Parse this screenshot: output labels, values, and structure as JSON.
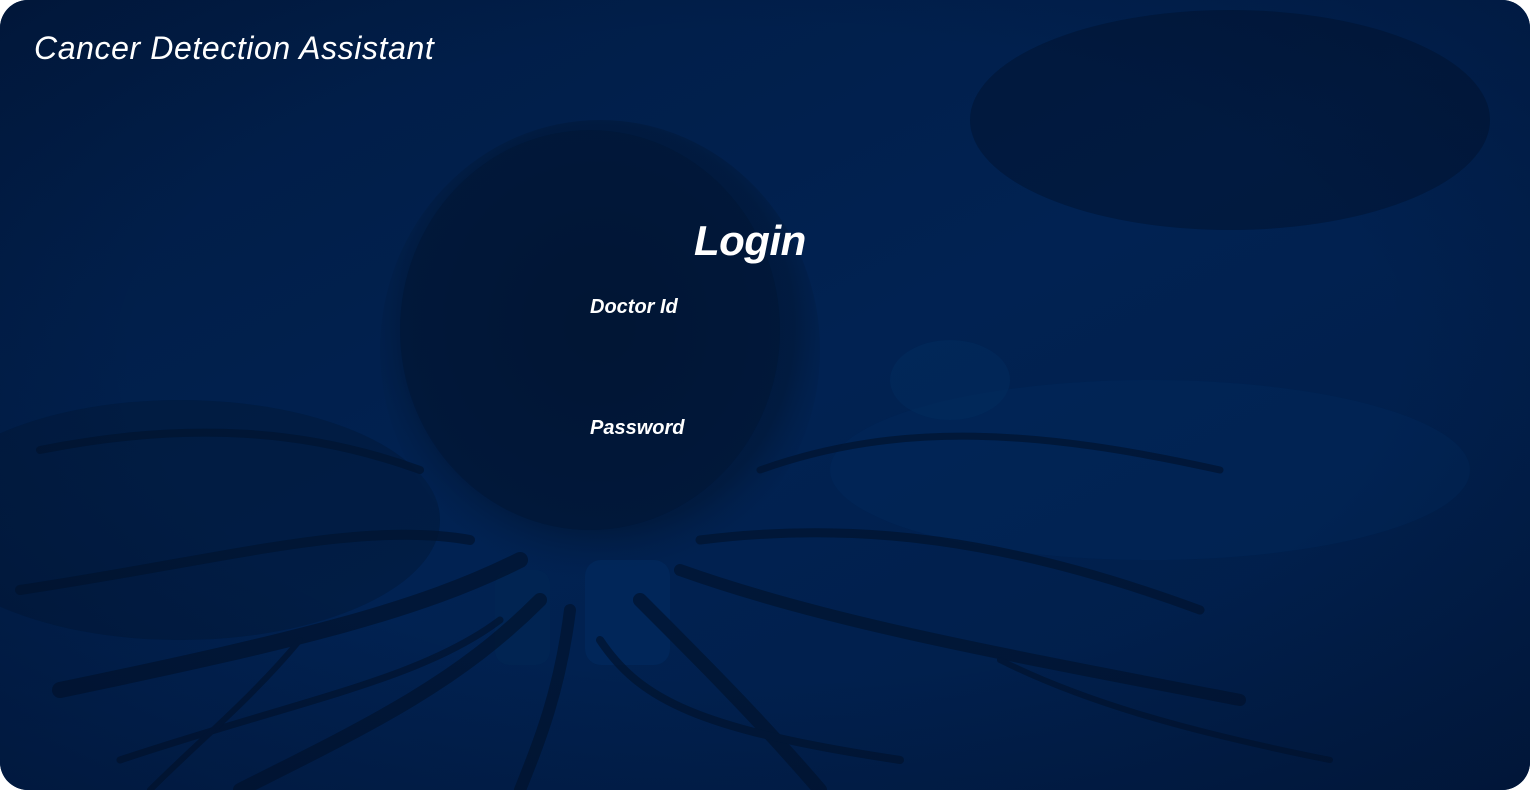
{
  "app": {
    "title": "Cancer Detection Assistant"
  },
  "login": {
    "heading": "Login",
    "doctor_id": {
      "label": "Doctor Id",
      "value": "",
      "placeholder": ""
    },
    "password": {
      "label": "Password",
      "value": "",
      "placeholder": ""
    }
  },
  "colors": {
    "background": "#012150",
    "background_dark": "#011533",
    "text": "#ffffff"
  }
}
